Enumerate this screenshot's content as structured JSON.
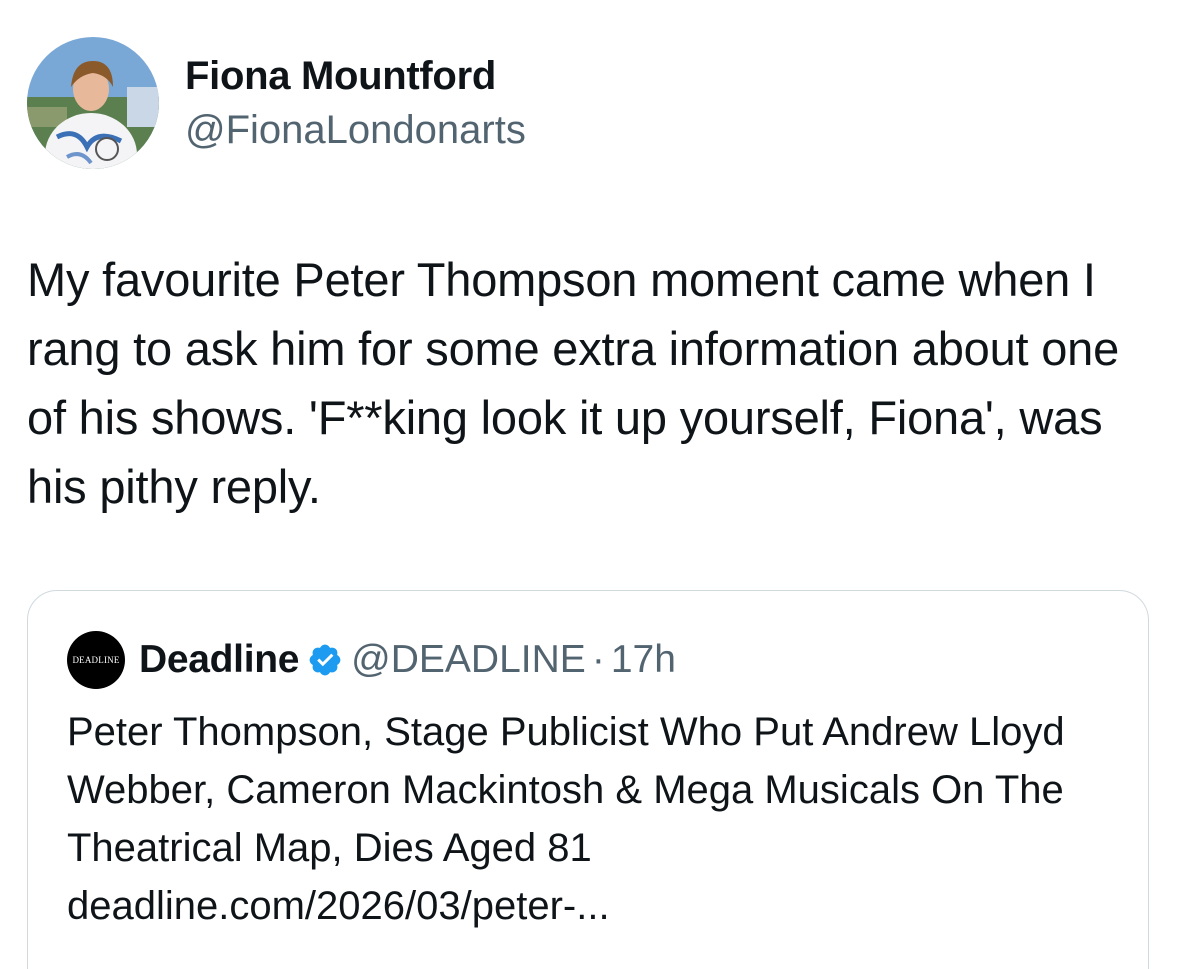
{
  "tweet": {
    "author_name": "Fiona Mountford",
    "author_handle": "@FionaLondonarts",
    "text": "My favourite Peter Thompson moment came when I rang to ask him for some extra information about one of his shows. 'F**king look it up yourself, Fiona', was his pithy reply."
  },
  "quote": {
    "logo_text": "DEADLINE",
    "name": "Deadline",
    "handle": "@DEADLINE",
    "separator": "·",
    "time": "17h",
    "headline": "Peter Thompson, Stage Publicist Who Put Andrew Lloyd Webber, Cameron Mackintosh & Mega Musicals On The Theatrical Map, Dies Aged 81",
    "link": "deadline.com/2026/03/peter-..."
  },
  "icons": {
    "verified": "verified-badge-icon"
  },
  "colors": {
    "text_primary": "#0f1419",
    "text_secondary": "#536471",
    "verified_blue": "#1d9bf0",
    "border": "#cfd9de"
  }
}
